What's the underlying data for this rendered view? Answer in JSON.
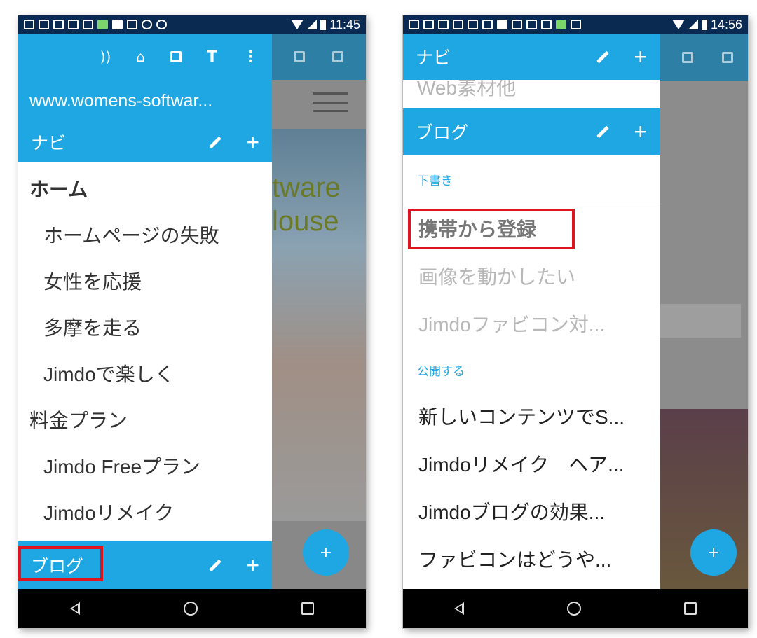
{
  "left": {
    "status_time": "11:45",
    "url": "www.womens-softwar...",
    "toolbar_icons": [
      "rss-icon",
      "cart-icon",
      "chart-icon",
      "paint-roller-icon",
      "more-vert-icon"
    ],
    "navi_header": "ナビ",
    "items": [
      {
        "label": "ホーム",
        "level": 1,
        "bold": true
      },
      {
        "label": "ホームページの失敗",
        "level": 2
      },
      {
        "label": "女性を応援",
        "level": 2
      },
      {
        "label": "多摩を走る",
        "level": 2
      },
      {
        "label": "Jimdoで楽しく",
        "level": 2
      },
      {
        "label": "料金プラン",
        "level": 1
      },
      {
        "label": "Jimdo Freeプラン",
        "level": 2
      },
      {
        "label": "Jimdoリメイク",
        "level": 2
      }
    ],
    "blog_header": "ブログ",
    "bg_text_1": "tware",
    "bg_text_2": "louse",
    "fab_label": "+"
  },
  "right": {
    "status_time": "14:56",
    "navi_header": "ナビ",
    "faded_item": "Web素材他",
    "blog_header": "ブログ",
    "draft_label": "下書き",
    "drafts": [
      "携帯から登録",
      "画像を動かしたい",
      "Jimdoファビコン対..."
    ],
    "publish_label": "公開する",
    "published": [
      "新しいコンテンツでS...",
      "Jimdoリメイク　ヘア...",
      "Jimdoブログの効果...",
      "ファビコンはどうや..."
    ],
    "fab_label": "+"
  },
  "colors": {
    "accent": "#1ea7e2",
    "highlight_box": "#e0141e",
    "status_bar": "#0b2a52"
  }
}
